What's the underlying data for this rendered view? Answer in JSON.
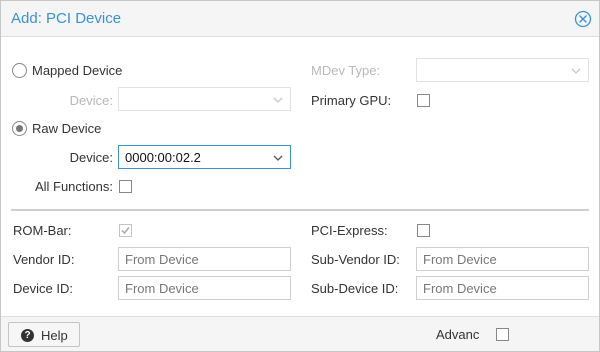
{
  "dialog": {
    "title": "Add: PCI Device"
  },
  "mapped": {
    "label": "Mapped Device",
    "device_label": "Device:",
    "mdev_label": "MDev Type:",
    "primary_gpu_label": "Primary GPU:"
  },
  "raw": {
    "label": "Raw Device",
    "device_label": "Device:",
    "device_value": "0000:00:02.2",
    "all_functions_label": "All Functions:"
  },
  "options": {
    "rom_bar_label": "ROM-Bar:",
    "pci_express_label": "PCI-Express:",
    "vendor_id_label": "Vendor ID:",
    "vendor_id_placeholder": "From Device",
    "sub_vendor_id_label": "Sub-Vendor ID:",
    "sub_vendor_id_placeholder": "From Device",
    "device_id_label": "Device ID:",
    "device_id_placeholder": "From Device",
    "sub_device_id_label": "Sub-Device ID:",
    "sub_device_id_placeholder": "From Device"
  },
  "footer": {
    "help_label": "Help",
    "advanced_label": "Advanc"
  },
  "colors": {
    "accent": "#3892d4",
    "header_bg": "#f5f5f5"
  }
}
